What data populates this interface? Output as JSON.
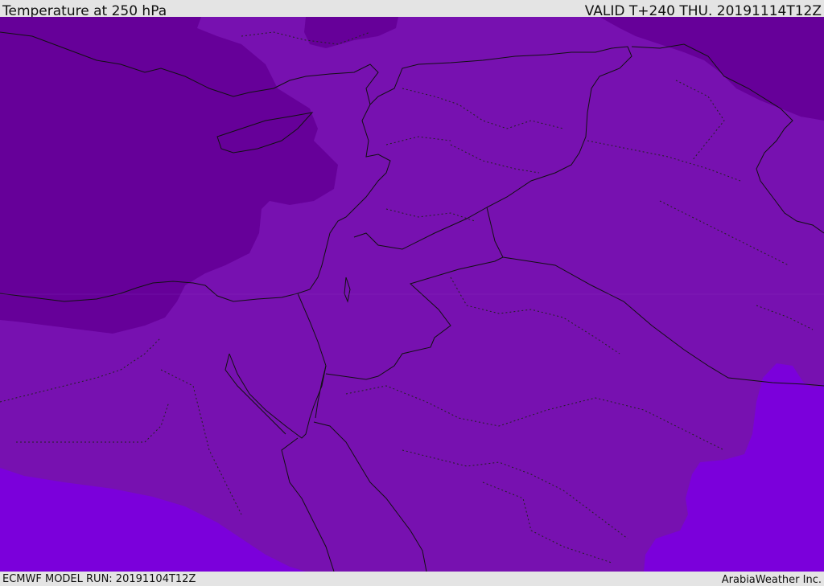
{
  "header": {
    "title": "Temperature at 250 hPa",
    "valid": "VALID T+240 THU. 20191114T12Z"
  },
  "footer": {
    "model_run": "ECMWF MODEL RUN: 20191104T12Z",
    "credit": "ArabiaWeather Inc."
  },
  "map": {
    "variable": "Temperature",
    "level": "250 hPa",
    "colors": {
      "cold_band": "#660099",
      "mid_band": "#7711b0",
      "warm_band": "#7b00db",
      "border": "#111111",
      "frame": "#e4e4e4"
    }
  }
}
